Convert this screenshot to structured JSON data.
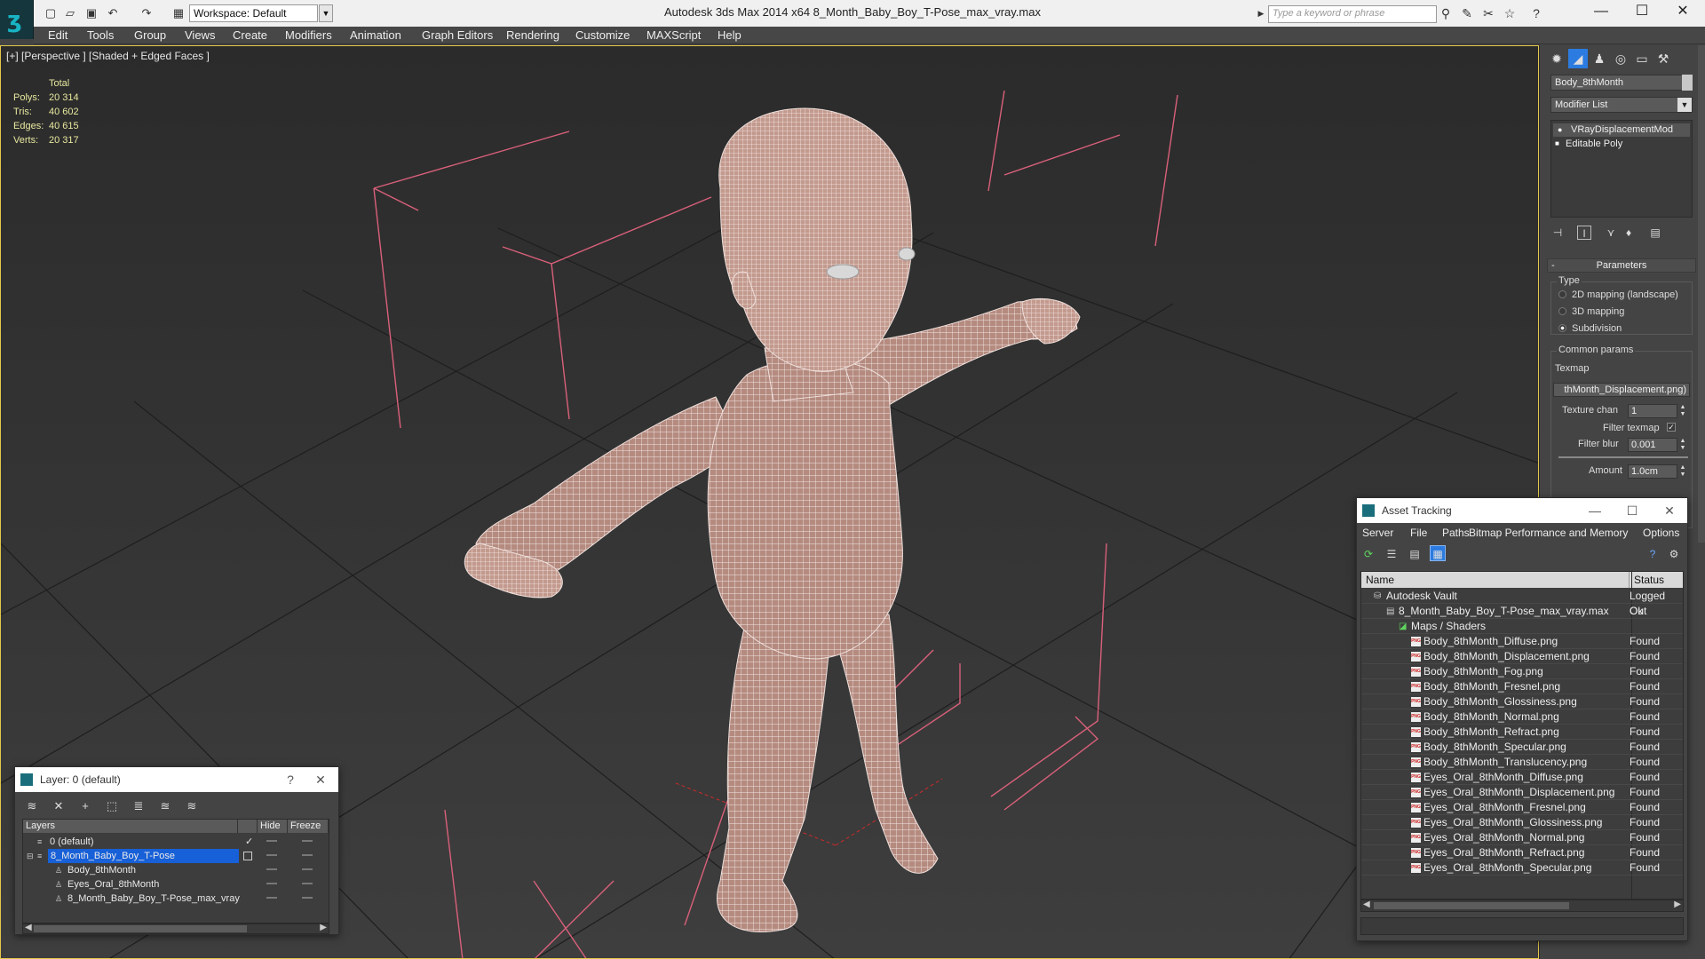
{
  "app": {
    "window_title": "Autodesk 3ds Max  2014 x64      8_Month_Baby_Boy_T-Pose_max_vray.max",
    "workspace_label": "Workspace: Default",
    "search_placeholder": "Type a keyword or phrase"
  },
  "menu": [
    "Edit",
    "Tools",
    "Group",
    "Views",
    "Create",
    "Modifiers",
    "Animation",
    "Graph Editors",
    "Rendering",
    "Customize",
    "MAXScript",
    "Help"
  ],
  "viewport": {
    "label": "[+] [Perspective ] [Shaded + Edged Faces ]",
    "stats": {
      "header": "Total",
      "rows": [
        {
          "label": "Polys:",
          "value": "20 314"
        },
        {
          "label": "Tris:",
          "value": "40 602"
        },
        {
          "label": "Edges:",
          "value": "40 615"
        },
        {
          "label": "Verts:",
          "value": "20 317"
        }
      ]
    }
  },
  "command_panel": {
    "object_name": "Body_8thMonth",
    "modifier_list": "Modifier List",
    "stack": [
      "VRayDisplacementMod",
      "Editable Poly"
    ],
    "parameters_title": "Parameters",
    "type_group": "Type",
    "type_options": [
      "2D mapping (landscape)",
      "3D mapping",
      "Subdivision"
    ],
    "type_selected": "Subdivision",
    "common_group": "Common params",
    "texmap_label": "Texmap",
    "texmap_value": "thMonth_Displacement.png)",
    "texture_chan_label": "Texture chan",
    "texture_chan_value": "1",
    "filter_texmap_label": "Filter texmap",
    "filter_blur_label": "Filter blur",
    "filter_blur_value": "0.001",
    "amount_label": "Amount",
    "amount_value": "1.0cm"
  },
  "layer_explorer": {
    "title": "Layer: 0 (default)",
    "columns": [
      "Layers",
      "Hide",
      "Freeze"
    ],
    "rows": [
      {
        "name": "0 (default)",
        "indent": 1,
        "kind": "layer"
      },
      {
        "name": "8_Month_Baby_Boy_T-Pose",
        "indent": 1,
        "kind": "layer",
        "selected": true
      },
      {
        "name": "Body_8thMonth",
        "indent": 2,
        "kind": "object"
      },
      {
        "name": "Eyes_Oral_8thMonth",
        "indent": 2,
        "kind": "object"
      },
      {
        "name": "8_Month_Baby_Boy_T-Pose_max_vray",
        "indent": 2,
        "kind": "object"
      }
    ]
  },
  "asset_tracking": {
    "title": "Asset Tracking",
    "menu": [
      "Server",
      "File",
      "Paths",
      "Bitmap Performance and Memory",
      "Options"
    ],
    "columns": [
      "Name",
      "Status"
    ],
    "rows": [
      {
        "name": "Autodesk Vault",
        "status": "Logged Out",
        "indent": 0,
        "kind": "vault"
      },
      {
        "name": "8_Month_Baby_Boy_T-Pose_max_vray.max",
        "status": "Ok",
        "indent": 1,
        "kind": "max"
      },
      {
        "name": "Maps / Shaders",
        "status": "",
        "indent": 2,
        "kind": "folder"
      },
      {
        "name": "Body_8thMonth_Diffuse.png",
        "status": "Found",
        "indent": 3,
        "kind": "png"
      },
      {
        "name": "Body_8thMonth_Displacement.png",
        "status": "Found",
        "indent": 3,
        "kind": "png"
      },
      {
        "name": "Body_8thMonth_Fog.png",
        "status": "Found",
        "indent": 3,
        "kind": "png"
      },
      {
        "name": "Body_8thMonth_Fresnel.png",
        "status": "Found",
        "indent": 3,
        "kind": "png"
      },
      {
        "name": "Body_8thMonth_Glossiness.png",
        "status": "Found",
        "indent": 3,
        "kind": "png"
      },
      {
        "name": "Body_8thMonth_Normal.png",
        "status": "Found",
        "indent": 3,
        "kind": "png"
      },
      {
        "name": "Body_8thMonth_Refract.png",
        "status": "Found",
        "indent": 3,
        "kind": "png"
      },
      {
        "name": "Body_8thMonth_Specular.png",
        "status": "Found",
        "indent": 3,
        "kind": "png"
      },
      {
        "name": "Body_8thMonth_Translucency.png",
        "status": "Found",
        "indent": 3,
        "kind": "png"
      },
      {
        "name": "Eyes_Oral_8thMonth_Diffuse.png",
        "status": "Found",
        "indent": 3,
        "kind": "png"
      },
      {
        "name": "Eyes_Oral_8thMonth_Displacement.png",
        "status": "Found",
        "indent": 3,
        "kind": "png"
      },
      {
        "name": "Eyes_Oral_8thMonth_Fresnel.png",
        "status": "Found",
        "indent": 3,
        "kind": "png"
      },
      {
        "name": "Eyes_Oral_8thMonth_Glossiness.png",
        "status": "Found",
        "indent": 3,
        "kind": "png"
      },
      {
        "name": "Eyes_Oral_8thMonth_Normal.png",
        "status": "Found",
        "indent": 3,
        "kind": "png"
      },
      {
        "name": "Eyes_Oral_8thMonth_Refract.png",
        "status": "Found",
        "indent": 3,
        "kind": "png"
      },
      {
        "name": "Eyes_Oral_8thMonth_Specular.png",
        "status": "Found",
        "indent": 3,
        "kind": "png"
      }
    ]
  },
  "icons": {
    "file_icon": "PNG"
  },
  "colors": {
    "viewport_border": "#e3c84a",
    "selection_blue": "#1760d8",
    "mesh_color": "#b98f84",
    "light_lines": "#d9607a"
  }
}
